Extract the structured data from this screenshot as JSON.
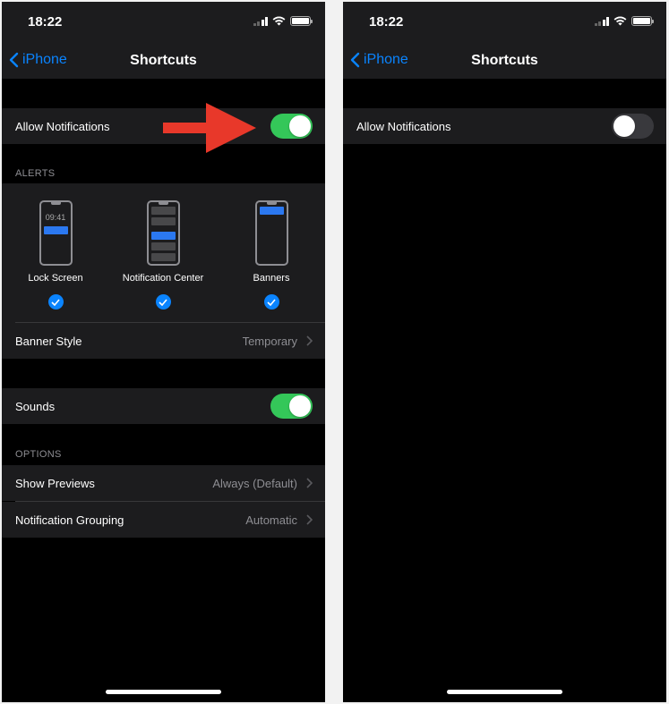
{
  "screens": {
    "left": {
      "status_bar": {
        "time": "18:22"
      },
      "nav": {
        "back_label": "iPhone",
        "title": "Shortcuts"
      },
      "allow_notifications": {
        "label": "Allow Notifications",
        "enabled": true
      },
      "alerts": {
        "header": "ALERTS",
        "options": [
          {
            "label": "Lock Screen",
            "checked": true,
            "preview_time": "09:41"
          },
          {
            "label": "Notification Center",
            "checked": true
          },
          {
            "label": "Banners",
            "checked": true
          }
        ]
      },
      "banner_style": {
        "label": "Banner Style",
        "value": "Temporary"
      },
      "sounds": {
        "label": "Sounds",
        "enabled": true
      },
      "options": {
        "header": "OPTIONS",
        "show_previews": {
          "label": "Show Previews",
          "value": "Always (Default)"
        },
        "notification_grouping": {
          "label": "Notification Grouping",
          "value": "Automatic"
        }
      }
    },
    "right": {
      "status_bar": {
        "time": "18:22"
      },
      "nav": {
        "back_label": "iPhone",
        "title": "Shortcuts"
      },
      "allow_notifications": {
        "label": "Allow Notifications",
        "enabled": false
      }
    }
  },
  "annotation": {
    "arrow_color": "#e8382a",
    "points_to": "allow-notifications-toggle"
  },
  "colors": {
    "toggle_on": "#34c759",
    "toggle_off": "#39393d",
    "accent": "#0a84ff",
    "background": "#000000",
    "row_background": "#1c1c1e"
  }
}
